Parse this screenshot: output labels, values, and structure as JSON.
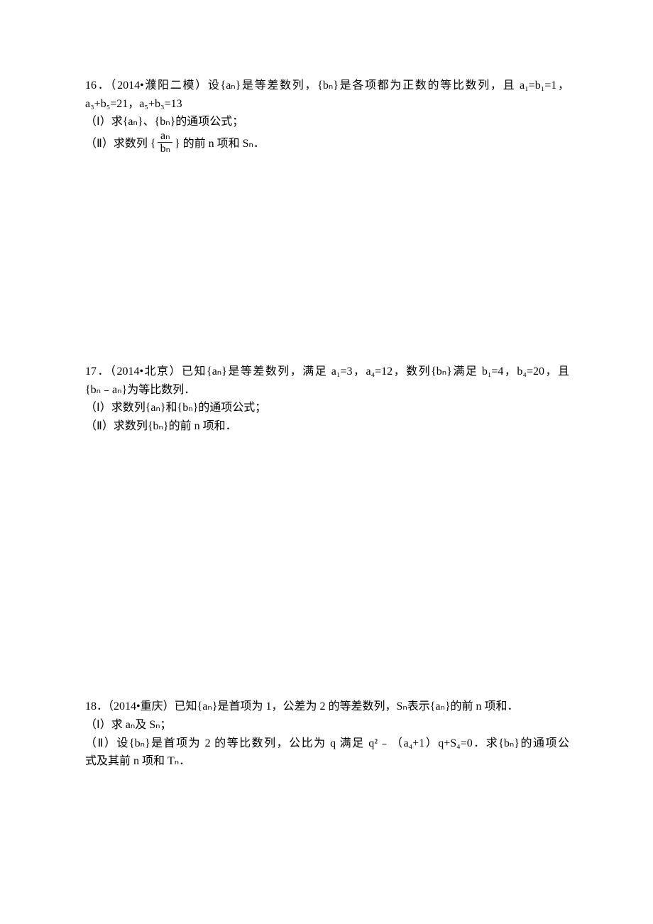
{
  "p16": {
    "l1": "16．（2014•濮阳二模）设{aₙ}是等差数列，{bₙ}是各项都为正数的等比数列，且 a₁=b₁=1，",
    "l2": "a₃+b₅=21，a₅+b₃=13",
    "l3": "（Ⅰ）求{aₙ}、{bₙ}的通项公式；",
    "l4a": "（Ⅱ）求数列 {",
    "frac_num": "aₙ",
    "frac_den": "bₙ",
    "l4b": "} 的前 n 项和 Sₙ．"
  },
  "p17": {
    "l1": "17．（2014•北京）已知{aₙ}是等差数列，满足 a₁=3，a₄=12，数列{bₙ}满足 b₁=4，b₄=20，且",
    "l2": "{bₙ﹣aₙ}为等比数列．",
    "l3": "（Ⅰ）求数列{aₙ}和{bₙ}的通项公式；",
    "l4": "（Ⅱ）求数列{bₙ}的前 n 项和．"
  },
  "p18": {
    "l1": "18．（2014•重庆）已知{aₙ}是首项为 1，公差为 2 的等差数列，Sₙ表示{aₙ}的前 n 项和．",
    "l2": "（Ⅰ）求 aₙ及 Sₙ；",
    "l3": "（Ⅱ）设{bₙ}是首项为 2 的等比数列，公比为 q 满足 q²﹣（a₄+1）q+S₄=0．求{bₙ}的通项公",
    "l4": "式及其前 n 项和 Tₙ．"
  }
}
